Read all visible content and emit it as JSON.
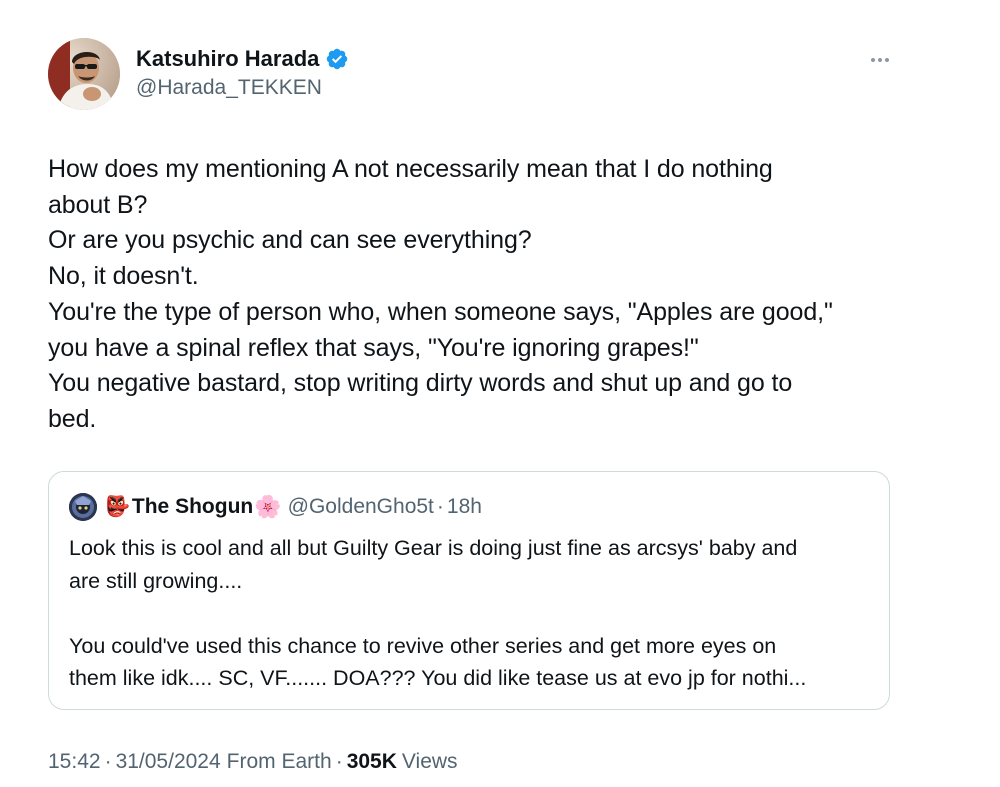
{
  "author": {
    "display_name": "Katsuhiro Harada",
    "handle": "@Harada_TEKKEN",
    "verified_icon": "verified-badge-icon",
    "badge_color": "#1d9bf0"
  },
  "tweet": {
    "text": "How does my mentioning A not necessarily mean that I do nothing\nabout B?\nOr are you psychic and can see everything?\nNo, it doesn't.\nYou're the type of person who, when someone says, \"Apples are good,\"\nyou have a spinal reflex that says, \"You're ignoring grapes!\"\nYou negative bastard, stop writing dirty words and shut up and go to\nbed."
  },
  "quote": {
    "name": "The Shogun",
    "name_emoji_left": "👺",
    "name_emoji_right": "🌸",
    "handle": "@GoldenGho5t",
    "separator": "·",
    "time": "18h",
    "text": "Look this is cool and all but Guilty Gear is doing just fine as arcsys' baby and\nare still growing....\n\nYou could've used this chance to revive other series and get more eyes on\nthem like idk.... SC, VF....... DOA??? You did like tease us at evo jp for nothi..."
  },
  "meta": {
    "time": "15:42",
    "separator": "·",
    "date": "31/05/2024",
    "source": "From Earth",
    "views_count": "305K",
    "views_label": "Views"
  },
  "icons": {
    "more": "more-options-icon",
    "avatar": "author-avatar",
    "quote_avatar": "quote-author-avatar"
  },
  "colors": {
    "text_primary": "#0f1419",
    "text_secondary": "#536471",
    "border": "#cfd9de",
    "verified": "#1d9bf0"
  }
}
